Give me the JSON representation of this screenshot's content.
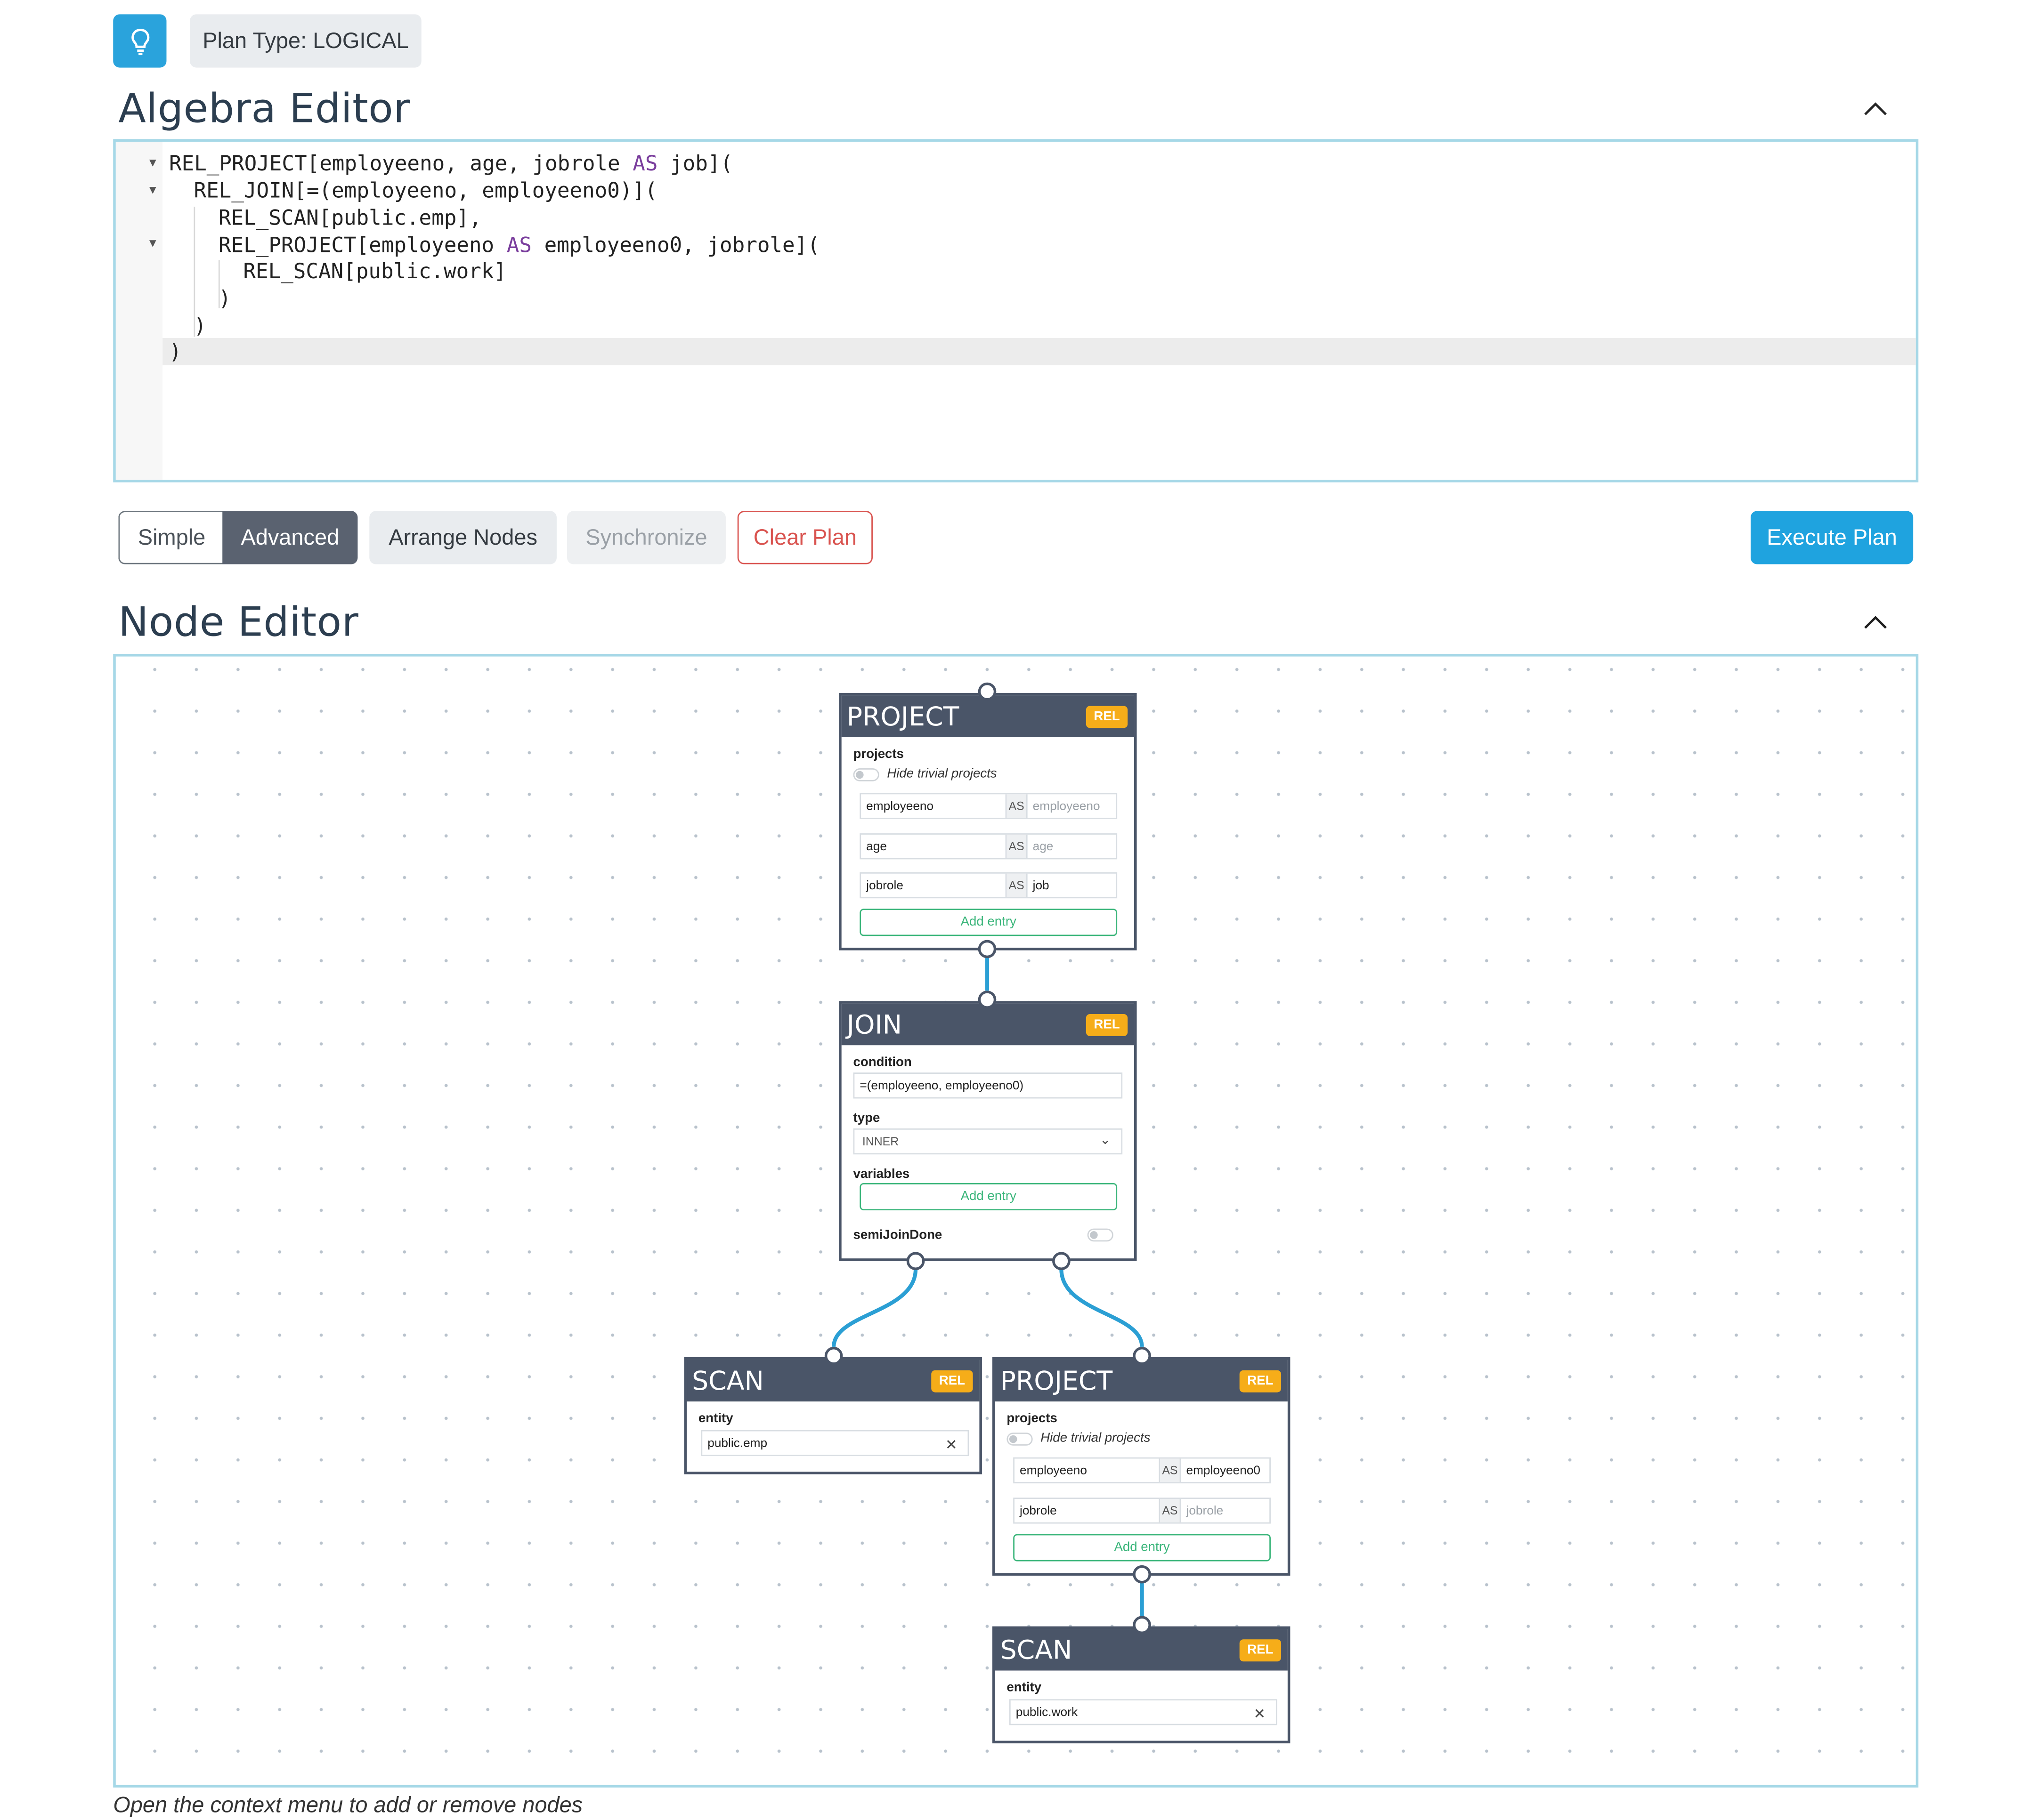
{
  "toolbar": {
    "plan_type": "Plan Type: LOGICAL",
    "icon": "lightbulb-icon"
  },
  "algebra": {
    "title": "Algebra Editor",
    "lines": [
      "REL_PROJECT[employeeno, age, jobrole AS job](",
      "REL_JOIN[=(employeeno, employeeno0)](",
      "REL_SCAN[public.emp],",
      "REL_PROJECT[employeeno AS employeeno0, jobrole](",
      "REL_SCAN[public.work]",
      ")",
      ")",
      ")"
    ]
  },
  "actions": {
    "simple": "Simple",
    "advanced": "Advanced",
    "arrange": "Arrange Nodes",
    "synchronize": "Synchronize",
    "clear": "Clear Plan",
    "execute": "Execute Plan"
  },
  "node_editor": {
    "title": "Node Editor",
    "hint": "Open the context menu to add or remove nodes",
    "badge": "REL",
    "add_entry": "Add entry",
    "as": "AS",
    "project_top": {
      "title": "PROJECT",
      "field": "projects",
      "toggle_label": "Hide trivial projects",
      "rows": [
        {
          "left": "employeeno",
          "right": "employeeno",
          "right_placeholder": true
        },
        {
          "left": "age",
          "right": "age",
          "right_placeholder": true
        },
        {
          "left": "jobrole",
          "right": "job",
          "right_placeholder": false
        }
      ]
    },
    "join": {
      "title": "JOIN",
      "condition_label": "condition",
      "condition_value": "=(employeeno, employeeno0)",
      "type_label": "type",
      "type_value": "INNER",
      "variables_label": "variables",
      "semijoin_label": "semiJoinDone"
    },
    "scan_emp": {
      "title": "SCAN",
      "field": "entity",
      "value": "public.emp"
    },
    "project_right": {
      "title": "PROJECT",
      "field": "projects",
      "toggle_label": "Hide trivial projects",
      "rows": [
        {
          "left": "employeeno",
          "right": "employeeno0",
          "right_placeholder": false
        },
        {
          "left": "jobrole",
          "right": "jobrole",
          "right_placeholder": true
        }
      ]
    },
    "scan_work": {
      "title": "SCAN",
      "field": "entity",
      "value": "public.work"
    }
  },
  "colors": {
    "accent": "#1fa3df",
    "node_header": "#4a5568",
    "badge": "#f6ad19",
    "wire": "#2b9fd4",
    "add_entry": "#3ab57a",
    "danger": "#d9534f"
  }
}
